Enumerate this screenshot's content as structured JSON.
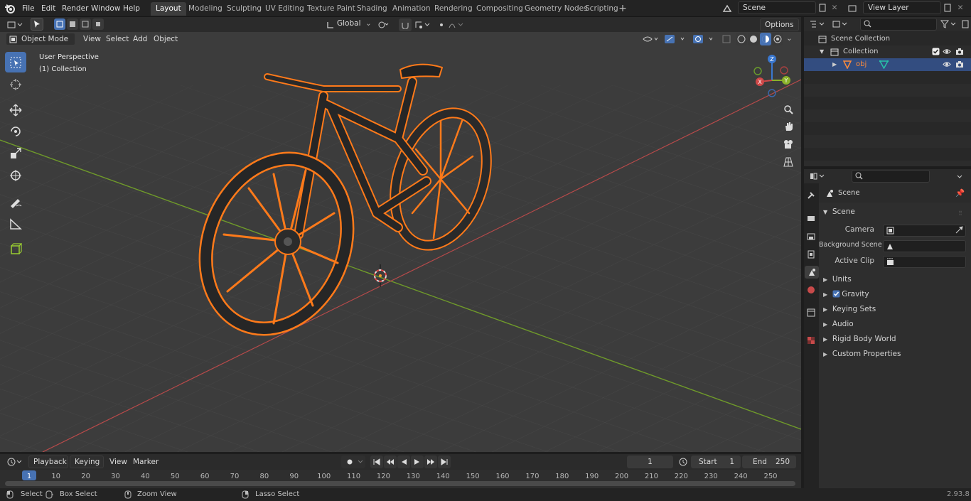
{
  "menu": [
    "File",
    "Edit",
    "Render",
    "Window",
    "Help"
  ],
  "workspaces": [
    "Layout",
    "Modeling",
    "Sculpting",
    "UV Editing",
    "Texture Paint",
    "Shading",
    "Animation",
    "Rendering",
    "Compositing",
    "Geometry Nodes",
    "Scripting"
  ],
  "scene_name": "Scene",
  "view_layer": "View Layer",
  "viewport": {
    "mode": "Object Mode",
    "menus": [
      "View",
      "Select",
      "Add",
      "Object"
    ],
    "orientation": "Global",
    "options": "Options",
    "perspective": "User Perspective",
    "collection": "(1) Collection",
    "gizmo": {
      "x": "X",
      "y": "Y",
      "z": "Z"
    }
  },
  "outliner": {
    "root": "Scene Collection",
    "collection": "Collection",
    "object": "obj"
  },
  "properties": {
    "header": "Scene",
    "panel": "Scene",
    "camera_label": "Camera",
    "bg_scene_label": "Background Scene",
    "active_clip_label": "Active Clip",
    "panels": [
      "Units",
      "Gravity",
      "Keying Sets",
      "Audio",
      "Rigid Body World",
      "Custom Properties"
    ]
  },
  "timeline": {
    "menus": [
      "Playback",
      "Keying",
      "View",
      "Marker"
    ],
    "current_frame": "1",
    "start_label": "Start",
    "start": "1",
    "end_label": "End",
    "end": "250",
    "ticks": [
      "1",
      "10",
      "20",
      "30",
      "40",
      "50",
      "60",
      "70",
      "80",
      "90",
      "100",
      "110",
      "120",
      "130",
      "140",
      "150",
      "160",
      "170",
      "180",
      "190",
      "200",
      "210",
      "220",
      "230",
      "240",
      "250"
    ]
  },
  "status": {
    "select": "Select",
    "box_select": "Box Select",
    "zoom_view": "Zoom View",
    "lasso_select": "Lasso Select",
    "version": "2.93.8"
  },
  "colors": {
    "accent": "#4772b3",
    "selection": "#ff7a1a",
    "x_axis": "#c94a4a",
    "y_axis": "#86b326"
  }
}
